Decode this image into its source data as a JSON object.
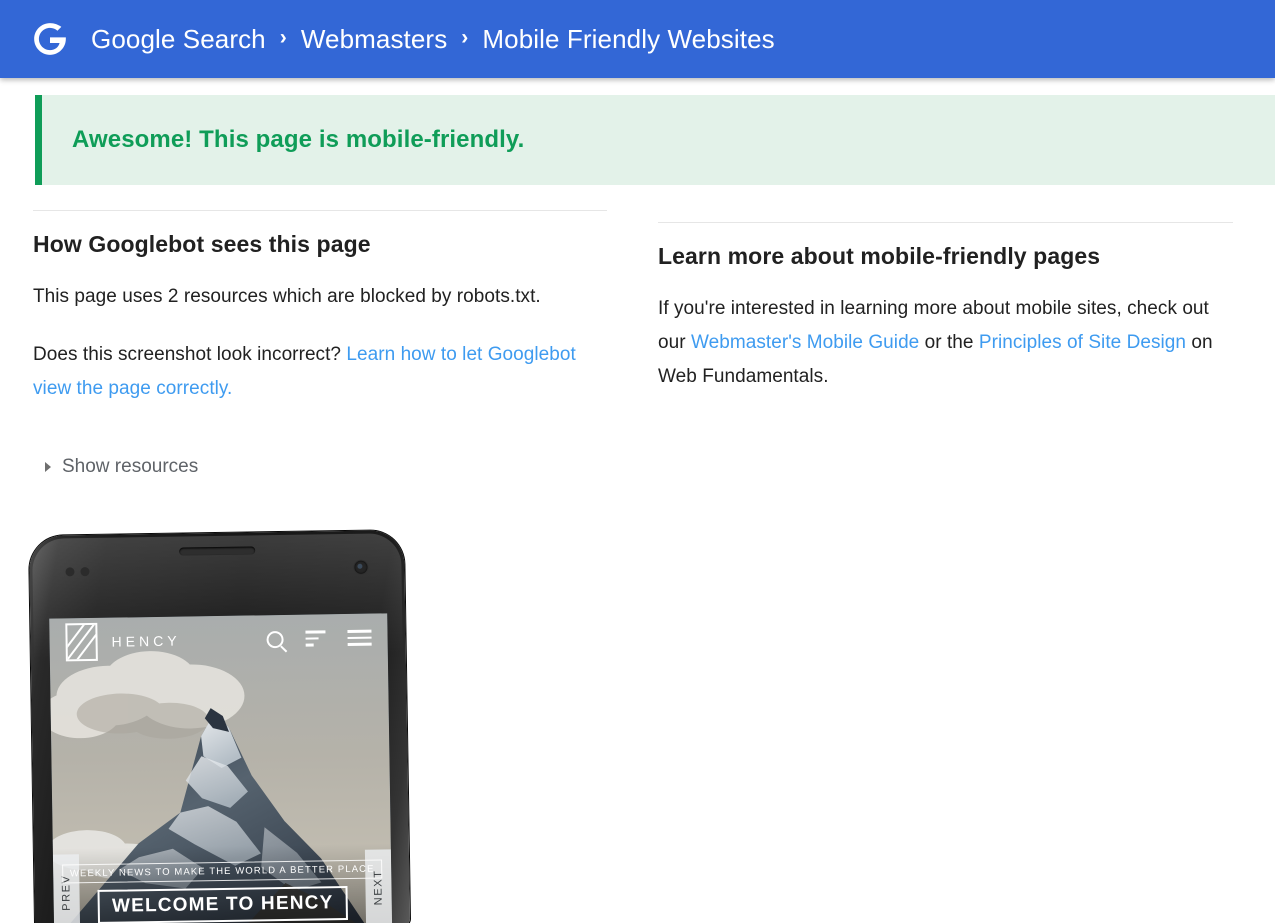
{
  "header": {
    "logo_icon": "google-g-icon",
    "breadcrumbs": [
      {
        "label": "Google Search"
      },
      {
        "label": "Webmasters"
      },
      {
        "label": "Mobile Friendly Websites"
      }
    ],
    "separator": "›",
    "background_color": "#3367d6"
  },
  "banner": {
    "message": "Awesome! This page is mobile-friendly.",
    "accent_color": "#0f9d58",
    "background_color": "#e3f2e9"
  },
  "left_column": {
    "title": "How Googlebot sees this page",
    "paragraph_1": "This page uses 2 resources which are blocked by robots.txt.",
    "paragraph_2_prefix": "Does this screenshot look incorrect? ",
    "paragraph_2_link": "Learn how to let Googlebot view the page correctly.",
    "disclosure_label": "Show resources",
    "disclosure_icon": "triangle-right-icon",
    "disclosure_expanded": false
  },
  "right_column": {
    "title": "Learn more about mobile-friendly pages",
    "text_part_1": "If you're interested in learning more about mobile sites, check out our ",
    "link_1": "Webmaster's Mobile Guide",
    "text_part_2": " or the ",
    "link_2": "Principles of Site Design",
    "text_part_3": " on Web Fundamentals.",
    "link_color": "#3e9bf0"
  },
  "preview": {
    "device": "android-phone-mockup",
    "site": {
      "brand": "HENCY",
      "brand_mark_icon": "hency-square-logo-icon",
      "icons": [
        "search-icon",
        "align-bars-icon",
        "hamburger-menu-icon"
      ],
      "hero_subtitle": "WEEKLY NEWS TO MAKE THE WORLD A BETTER PLACE",
      "hero_title": "WELCOME TO HENCY",
      "prev_label": "PREV",
      "next_label": "NEXT",
      "hero_image": "snow-capped-mountain-peak-with-clouds"
    }
  }
}
